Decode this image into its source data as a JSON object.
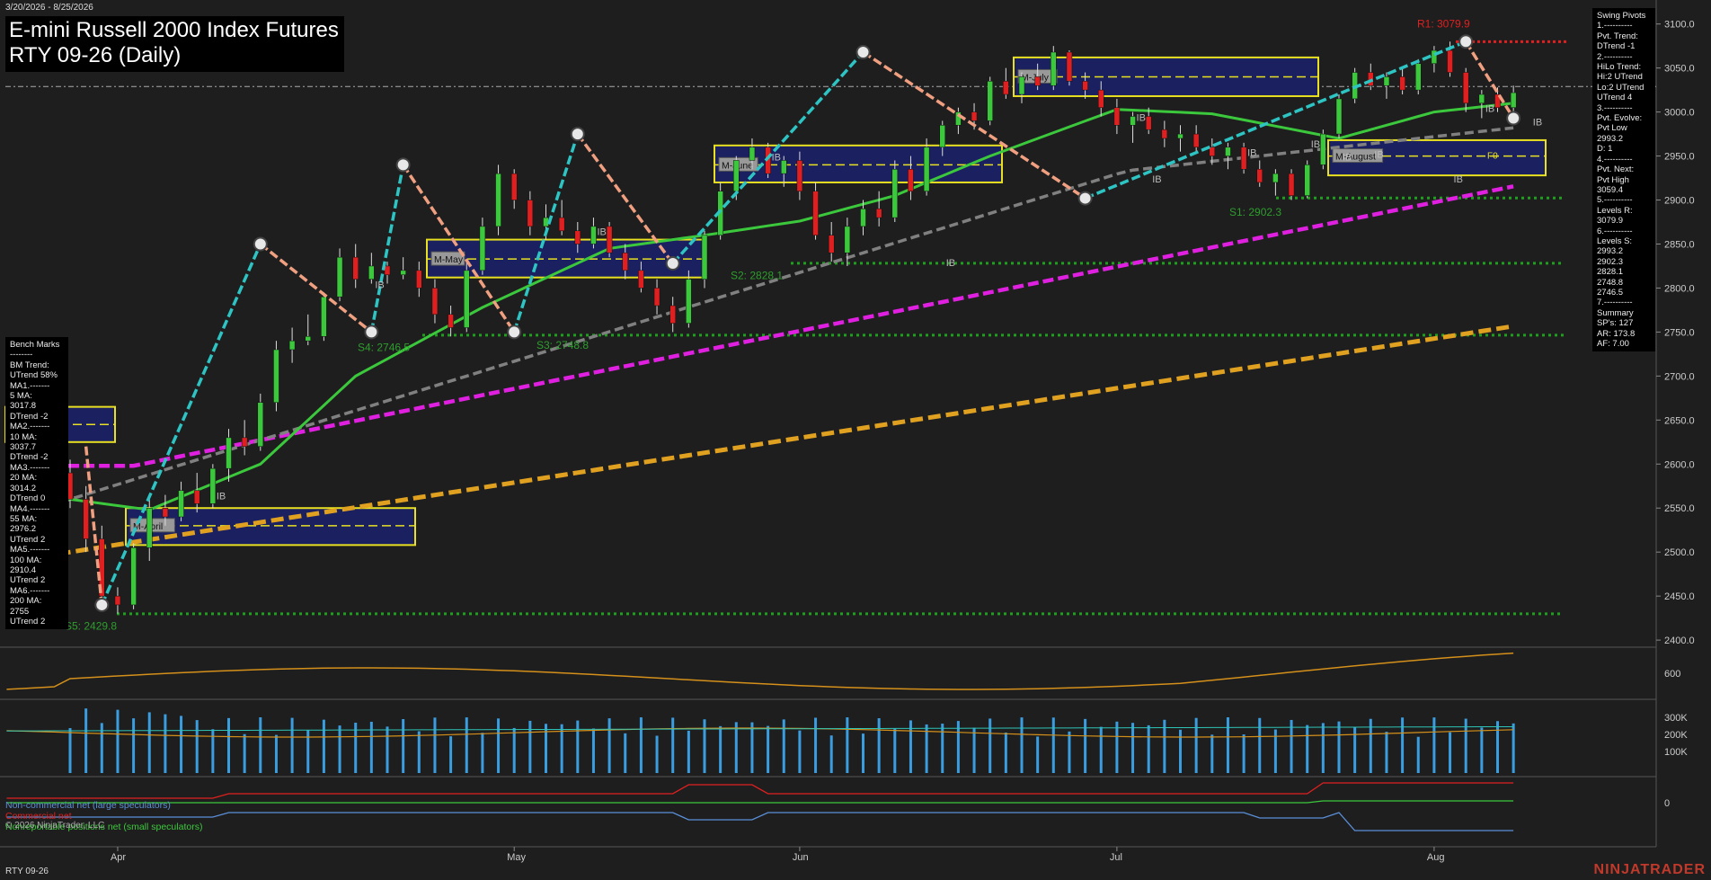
{
  "header": {
    "date_range": "3/20/2026 - 8/25/2026",
    "title_line1": "E-mini Russell 2000 Index Futures",
    "title_line2": "RTY 09-26 (Daily)"
  },
  "footer": {
    "symbol": "RTY 09-26",
    "brand": "NINJATRADER",
    "copyright": "© 2026 NinjaTrader, LLC"
  },
  "swing_pivots_panel": {
    "lines": [
      "Swing Pivots",
      "1.----------",
      "Pvt. Trend:",
      "DTrend -1",
      "2.----------",
      "HiLo Trend:",
      "Hi:2 UTrend",
      "Lo:2 UTrend",
      "UTrend 4",
      "3.----------",
      "Pvt. Evolve:",
      "Pvt Low",
      "2993.2",
      "D: 1",
      "4.----------",
      "Pvt. Next:",
      "Pvt High",
      "3059.4",
      "5.----------",
      "Levels R:",
      "3079.9",
      "6.----------",
      "Levels S:",
      "2993.2",
      "2902.3",
      "2828.1",
      "2748.8",
      "2746.5",
      "7.----------",
      "Summary",
      "SP's: 127",
      "AR: 173.8",
      "AF: 7.00"
    ]
  },
  "benchmarks_panel": {
    "lines": [
      "Bench Marks",
      "--------",
      "BM Trend:",
      "UTrend 58%",
      "MA1.-------",
      "5 MA:",
      "3017.8",
      "DTrend -2",
      "MA2.-------",
      "10 MA:",
      "3037.7",
      "DTrend -2",
      "MA3.-------",
      "20 MA:",
      "3014.2",
      "DTrend 0",
      "MA4.-------",
      "55 MA:",
      "2976.2",
      "UTrend 2",
      "MA5.-------",
      "100 MA:",
      "2910.4",
      "UTrend 2",
      "MA6.-------",
      "200 MA:",
      "2755",
      "UTrend 2"
    ]
  },
  "cot_legend": [
    {
      "label": "Non-commercial net (large speculators)",
      "color": "#5b8fd9"
    },
    {
      "label": "Commercial net",
      "color": "#e02020"
    },
    {
      "label": "Nonreportable positions net (small speculators)",
      "color": "#3cc83c"
    }
  ],
  "chart_data": {
    "type": "candlestick",
    "title": "E-mini Russell 2000 Index Futures RTY 09-26 (Daily)",
    "x_ticks": [
      "Apr",
      "May",
      "Jun",
      "Jul",
      "Aug"
    ],
    "y_ticks": [
      2400,
      2450,
      2500,
      2550,
      2600,
      2650,
      2700,
      2750,
      2800,
      2850,
      2900,
      2950,
      3000,
      3050,
      3100
    ],
    "y_tick_labels": [
      "2400.0",
      "2450.0",
      "2500.0",
      "2550.0",
      "2600.0",
      "2650.0",
      "2700.0",
      "2750.0",
      "2800.0",
      "2850.0",
      "2900.0",
      "2950.0",
      "3000.0",
      "3050.0",
      "3100.0"
    ],
    "ylim": [
      2395,
      3115
    ],
    "current_price": 3022,
    "ohlc": [
      [
        2590,
        2605,
        2550,
        2560
      ],
      [
        2560,
        2575,
        2500,
        2515
      ],
      [
        2515,
        2530,
        2440,
        2450
      ],
      [
        2450,
        2460,
        2430,
        2440
      ],
      [
        2440,
        2510,
        2435,
        2505
      ],
      [
        2505,
        2560,
        2490,
        2550
      ],
      [
        2550,
        2565,
        2530,
        2540
      ],
      [
        2540,
        2580,
        2535,
        2570
      ],
      [
        2570,
        2590,
        2545,
        2555
      ],
      [
        2555,
        2600,
        2550,
        2595
      ],
      [
        2595,
        2640,
        2580,
        2630
      ],
      [
        2630,
        2650,
        2610,
        2620
      ],
      [
        2620,
        2680,
        2615,
        2670
      ],
      [
        2670,
        2740,
        2660,
        2730
      ],
      [
        2730,
        2755,
        2715,
        2740
      ],
      [
        2740,
        2770,
        2735,
        2745
      ],
      [
        2745,
        2795,
        2740,
        2790
      ],
      [
        2790,
        2845,
        2785,
        2835
      ],
      [
        2835,
        2850,
        2800,
        2810
      ],
      [
        2810,
        2840,
        2805,
        2825
      ],
      [
        2825,
        2830,
        2805,
        2815
      ],
      [
        2815,
        2835,
        2810,
        2820
      ],
      [
        2820,
        2830,
        2790,
        2800
      ],
      [
        2800,
        2810,
        2760,
        2770
      ],
      [
        2770,
        2780,
        2745,
        2755
      ],
      [
        2755,
        2830,
        2750,
        2820
      ],
      [
        2820,
        2880,
        2815,
        2870
      ],
      [
        2870,
        2940,
        2860,
        2930
      ],
      [
        2930,
        2935,
        2890,
        2900
      ],
      [
        2900,
        2910,
        2860,
        2870
      ],
      [
        2870,
        2895,
        2855,
        2880
      ],
      [
        2880,
        2900,
        2860,
        2865
      ],
      [
        2865,
        2875,
        2840,
        2850
      ],
      [
        2850,
        2880,
        2845,
        2870
      ],
      [
        2870,
        2875,
        2835,
        2840
      ],
      [
        2840,
        2850,
        2810,
        2820
      ],
      [
        2820,
        2830,
        2795,
        2800
      ],
      [
        2800,
        2810,
        2770,
        2780
      ],
      [
        2780,
        2790,
        2750,
        2760
      ],
      [
        2760,
        2820,
        2755,
        2810
      ],
      [
        2810,
        2865,
        2800,
        2860
      ],
      [
        2860,
        2920,
        2855,
        2910
      ],
      [
        2910,
        2950,
        2900,
        2945
      ],
      [
        2945,
        2970,
        2935,
        2960
      ],
      [
        2960,
        2965,
        2925,
        2930
      ],
      [
        2930,
        2950,
        2915,
        2945
      ],
      [
        2945,
        2955,
        2900,
        2910
      ],
      [
        2910,
        2920,
        2855,
        2860
      ],
      [
        2860,
        2875,
        2830,
        2840
      ],
      [
        2840,
        2880,
        2825,
        2870
      ],
      [
        2870,
        2900,
        2860,
        2890
      ],
      [
        2890,
        2910,
        2870,
        2880
      ],
      [
        2880,
        2945,
        2875,
        2935
      ],
      [
        2935,
        2950,
        2900,
        2910
      ],
      [
        2910,
        2970,
        2905,
        2960
      ],
      [
        2960,
        2990,
        2950,
        2985
      ],
      [
        2985,
        3005,
        2975,
        3000
      ],
      [
        3000,
        3010,
        2980,
        2990
      ],
      [
        2990,
        3040,
        2985,
        3035
      ],
      [
        3035,
        3050,
        3015,
        3020
      ],
      [
        3020,
        3045,
        3010,
        3040
      ],
      [
        3040,
        3055,
        3025,
        3030
      ],
      [
        3030,
        3075,
        3025,
        3068
      ],
      [
        3068,
        3070,
        3030,
        3035
      ],
      [
        3035,
        3045,
        3015,
        3025
      ],
      [
        3025,
        3035,
        2995,
        3005
      ],
      [
        3005,
        3015,
        2975,
        2985
      ],
      [
        2985,
        3000,
        2965,
        2995
      ],
      [
        2995,
        3005,
        2975,
        2980
      ],
      [
        2980,
        2990,
        2960,
        2970
      ],
      [
        2970,
        2985,
        2955,
        2975
      ],
      [
        2975,
        2985,
        2955,
        2960
      ],
      [
        2960,
        2970,
        2940,
        2950
      ],
      [
        2950,
        2965,
        2935,
        2960
      ],
      [
        2960,
        2965,
        2930,
        2935
      ],
      [
        2935,
        2945,
        2915,
        2920
      ],
      [
        2920,
        2935,
        2905,
        2930
      ],
      [
        2930,
        2935,
        2900,
        2905
      ],
      [
        2905,
        2945,
        2902,
        2940
      ],
      [
        2940,
        2980,
        2935,
        2975
      ],
      [
        2975,
        3020,
        2970,
        3015
      ],
      [
        3015,
        3050,
        3010,
        3045
      ],
      [
        3045,
        3055,
        3025,
        3030
      ],
      [
        3030,
        3045,
        3015,
        3040
      ],
      [
        3040,
        3050,
        3020,
        3025
      ],
      [
        3025,
        3060,
        3020,
        3055
      ],
      [
        3055,
        3075,
        3045,
        3070
      ],
      [
        3070,
        3080,
        3040,
        3045
      ],
      [
        3045,
        3050,
        3000,
        3010
      ],
      [
        3010,
        3025,
        2993,
        3020
      ],
      [
        3020,
        3028,
        3000,
        3005
      ],
      [
        3005,
        3030,
        3000,
        3022
      ]
    ],
    "moving_averages": [
      {
        "name": "5 MA",
        "color": "#2ec4b6",
        "value": 3017.8
      },
      {
        "name": "20 MA",
        "color": "#3cc83c",
        "value": 3014.2
      },
      {
        "name": "55 MA",
        "color": "#888888",
        "value": 2976.2
      },
      {
        "name": "100 MA",
        "color": "#e020e0",
        "value": 2910.4
      },
      {
        "name": "200 MA",
        "color": "#e0a020",
        "value": 2755
      }
    ],
    "pivot_labels": [
      {
        "text": "R1: 3079.9",
        "color": "#e02020",
        "price": 3079.9
      },
      {
        "text": "S1: 2902.3",
        "color": "#2e9e2e",
        "price": 2902.3
      },
      {
        "text": "S2: 2828.1",
        "color": "#2e9e2e",
        "price": 2828.1
      },
      {
        "text": "S3: 2748.8",
        "color": "#2e9e2e",
        "price": 2748.8
      },
      {
        "text": "S4: 2746.5",
        "color": "#2e9e2e",
        "price": 2746.5
      },
      {
        "text": "S5: 2429.8",
        "color": "#2e9e2e",
        "price": 2429.8
      }
    ],
    "monthly_boxes": [
      "M-April",
      "M-May",
      "M-June",
      "M-July",
      "M-August"
    ],
    "f0_label": "F0",
    "ib_label": "IB",
    "volume_axis_labels": [
      "300K",
      "200K",
      "100K"
    ],
    "atr_axis_label": "600",
    "cot_axis_label": "0"
  }
}
